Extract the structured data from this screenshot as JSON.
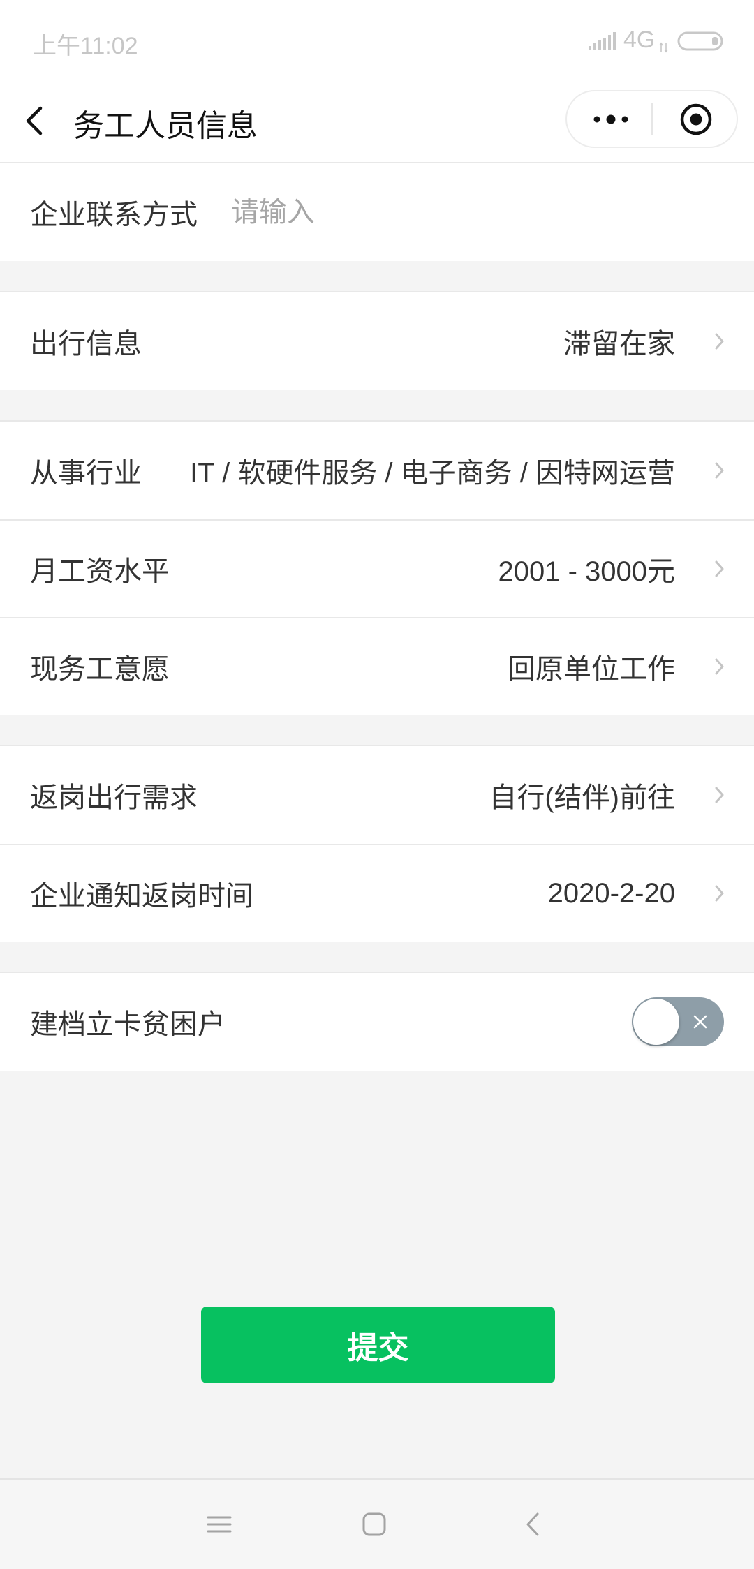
{
  "status_bar": {
    "time": "上午11:02",
    "network": "4G",
    "icons": [
      "signal-icon",
      "data-activity-icon",
      "battery-icon"
    ]
  },
  "header": {
    "title": "务工人员信息",
    "icons": [
      "back-chevron-icon",
      "more-dots-icon",
      "target-close-icon"
    ]
  },
  "form": {
    "contact": {
      "label": "企业联系方式",
      "placeholder": "请输入"
    },
    "travel": {
      "label": "出行信息",
      "value": "滞留在家"
    },
    "industry": {
      "label": "从事行业",
      "value": "IT / 软硬件服务 / 电子商务 / 因特网运营"
    },
    "salary": {
      "label": "月工资水平",
      "value": "2001 - 3000元"
    },
    "intention": {
      "label": "现务工意愿",
      "value": "回原单位工作"
    },
    "return_travel": {
      "label": "返岗出行需求",
      "value": "自行(结伴)前往"
    },
    "return_date": {
      "label": "企业通知返岗时间",
      "value": "2020-2-20"
    },
    "poverty": {
      "label": "建档立卡贫困户",
      "checked": false
    }
  },
  "submit": {
    "label": "提交"
  },
  "colors": {
    "accent": "#07c160",
    "toggle_off": "#8e9ea8",
    "background": "#f4f4f4"
  },
  "system_nav": {
    "icons": [
      "menu-icon",
      "home-icon",
      "back-icon"
    ]
  }
}
